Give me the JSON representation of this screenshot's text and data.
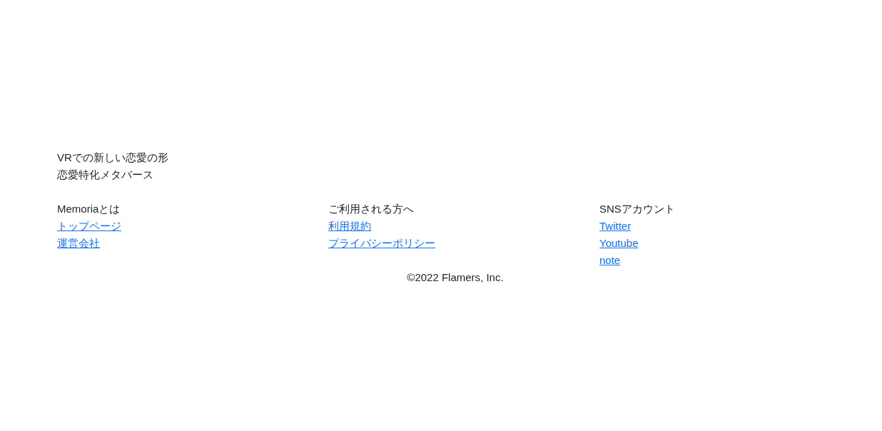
{
  "tagline": [
    "VRでの新しい恋愛の形",
    "恋愛特化メタバース"
  ],
  "columns": [
    {
      "heading": "Memoriaとは",
      "links": [
        "トップページ",
        "運営会社"
      ]
    },
    {
      "heading": "ご利用される方へ",
      "links": [
        "利用規約",
        "プライバシーポリシー"
      ]
    },
    {
      "heading": "SNSアカウント",
      "links": [
        "Twitter",
        "Youtube",
        "note"
      ]
    }
  ],
  "copyright": "©2022 Flamers, Inc."
}
